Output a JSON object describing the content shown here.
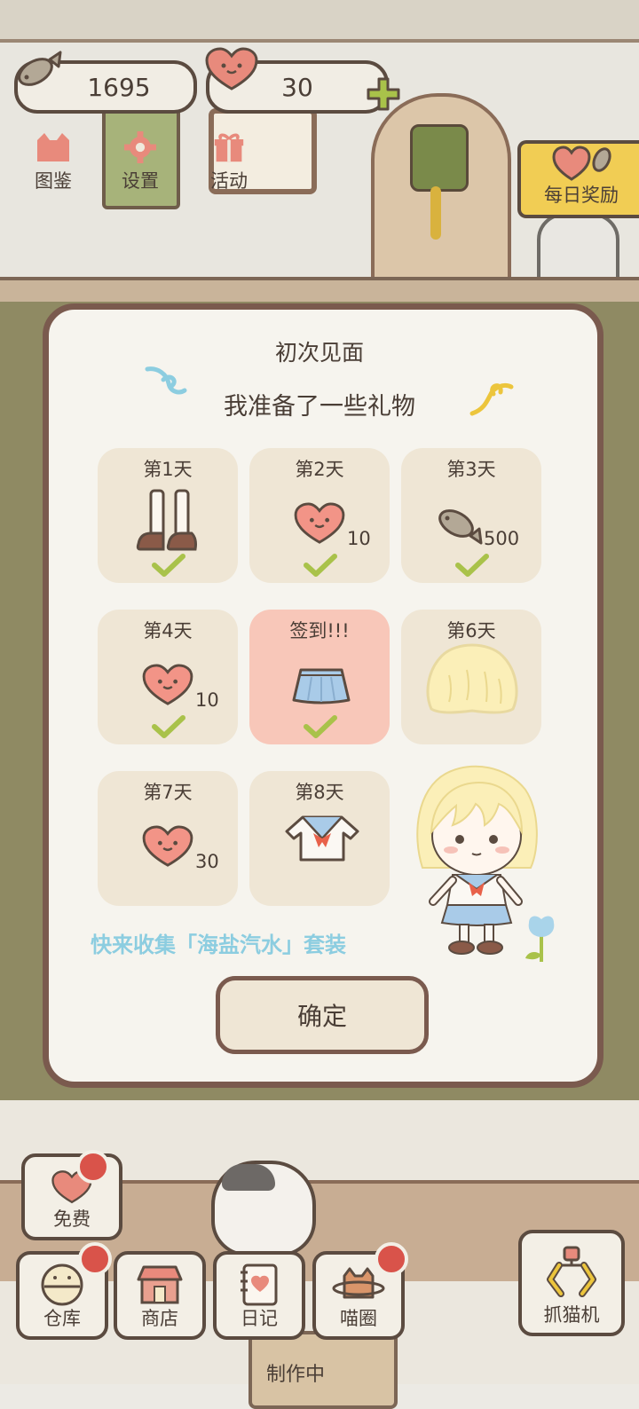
{
  "hud": {
    "fish_count": "1695",
    "heart_count": "30",
    "menu": [
      {
        "label": "图鉴",
        "icon": "cat-face-icon"
      },
      {
        "label": "设置",
        "icon": "gear-icon"
      },
      {
        "label": "活动",
        "icon": "gift-icon"
      }
    ],
    "daily_reward": "每日奖励"
  },
  "dialog": {
    "title": "初次见面",
    "subtitle": "我准备了一些礼物",
    "rewards": [
      {
        "label": "第1天",
        "item": "socks-shoes-icon",
        "qty": "",
        "claimed": true
      },
      {
        "label": "第2天",
        "item": "heart-icon",
        "qty": "10",
        "claimed": true
      },
      {
        "label": "第3天",
        "item": "fish-icon",
        "qty": "500",
        "claimed": true
      },
      {
        "label": "第4天",
        "item": "heart-icon",
        "qty": "10",
        "claimed": true
      },
      {
        "label": "签到!!!",
        "item": "skirt-icon",
        "qty": "",
        "claimed": true,
        "today": true
      },
      {
        "label": "第6天",
        "item": "blonde-hair-icon",
        "qty": "",
        "claimed": false
      },
      {
        "label": "第7天",
        "item": "heart-icon",
        "qty": "30",
        "claimed": false
      },
      {
        "label": "第8天",
        "item": "sailor-top-icon",
        "qty": "",
        "claimed": false
      }
    ],
    "collect_text": "快来收集「海盐汽水」套装",
    "confirm_label": "确定"
  },
  "bottom_bar": {
    "free_label": "免费",
    "items": [
      {
        "label": "仓库",
        "badge": true
      },
      {
        "label": "商店",
        "badge": false
      },
      {
        "label": "日记",
        "badge": false
      },
      {
        "label": "喵圈",
        "badge": true
      }
    ],
    "catch_label": "抓猫机",
    "making_label": "制作中"
  },
  "colors": {
    "accent_pink": "#f8c7b9",
    "card_bg": "#efe6d5",
    "check_green": "#a9c24a",
    "collect_text": "#8ccde0",
    "badge_red": "#d9534a",
    "daily_yellow": "#f1cd54"
  }
}
